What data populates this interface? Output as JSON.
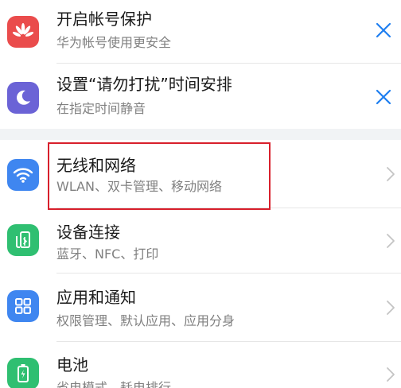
{
  "suggestions": [
    {
      "title": "开启帐号保护",
      "subtitle": "华为帐号使用更安全",
      "icon": "huawei-logo-icon",
      "icon_color": "#ea4c4c"
    },
    {
      "title": "设置“请勿打扰”时间安排",
      "subtitle": "在指定时间静音",
      "icon": "moon-icon",
      "icon_color": "#6b63d6"
    }
  ],
  "settings": [
    {
      "title": "无线和网络",
      "subtitle": "WLAN、双卡管理、移动网络",
      "icon": "wifi-icon",
      "icon_color": "#3f86f0",
      "highlighted": true
    },
    {
      "title": "设备连接",
      "subtitle": "蓝牙、NFC、打印",
      "icon": "device-connect-icon",
      "icon_color": "#2fbf71"
    },
    {
      "title": "应用和通知",
      "subtitle": "权限管理、默认应用、应用分身",
      "icon": "apps-grid-icon",
      "icon_color": "#3f86f0"
    },
    {
      "title": "电池",
      "subtitle": "省电模式、耗电排行",
      "icon": "battery-icon",
      "icon_color": "#2fbf71"
    }
  ],
  "colors": {
    "accent_blue": "#1f7ff0",
    "highlight_red": "#d8202c",
    "gap_gray": "#f1f3f5"
  }
}
